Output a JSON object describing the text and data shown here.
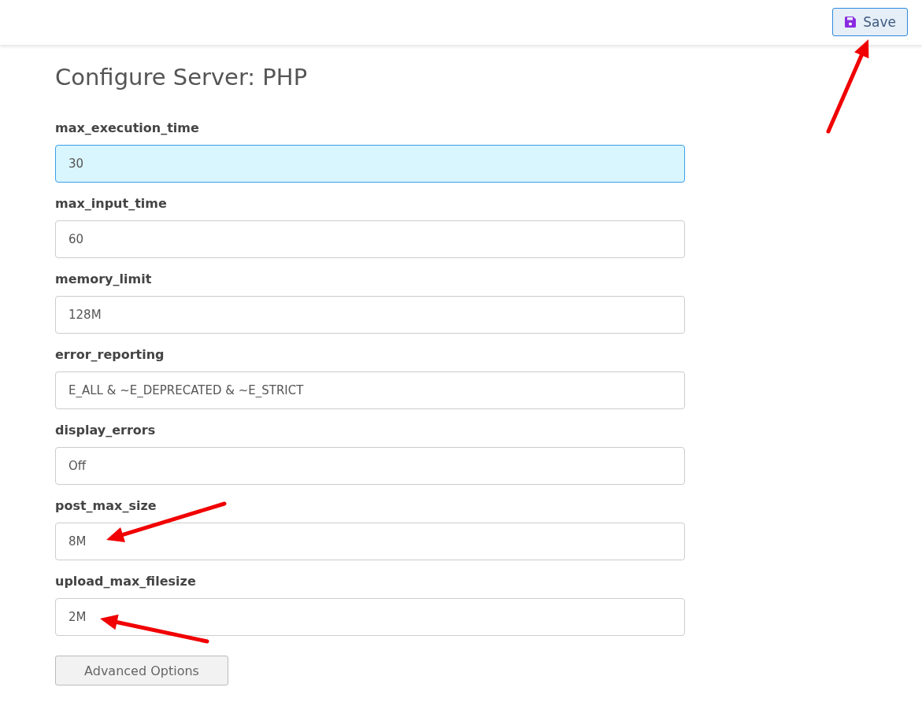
{
  "toolbar": {
    "save_button": "Save"
  },
  "title": "Configure Server: PHP",
  "fields": [
    {
      "label": "max_execution_time",
      "value": "30",
      "focused": true
    },
    {
      "label": "max_input_time",
      "value": "60",
      "focused": false
    },
    {
      "label": "memory_limit",
      "value": "128M",
      "focused": false
    },
    {
      "label": "error_reporting",
      "value": "E_ALL & ~E_DEPRECATED & ~E_STRICT",
      "focused": false
    },
    {
      "label": "display_errors",
      "value": "Off",
      "focused": false
    },
    {
      "label": "post_max_size",
      "value": "8M",
      "focused": false
    },
    {
      "label": "upload_max_filesize",
      "value": "2M",
      "focused": false
    }
  ],
  "advanced_button": "Advanced Options"
}
